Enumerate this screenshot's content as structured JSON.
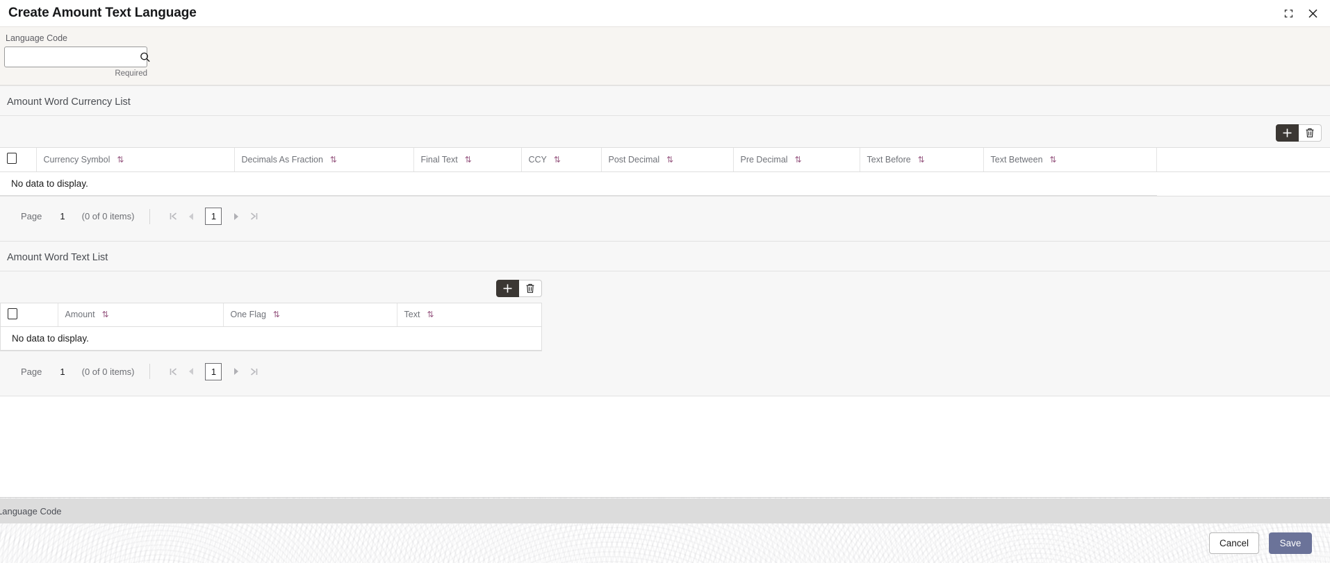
{
  "window": {
    "title": "Create Amount Text Language",
    "minimize_icon": "collapse-icon",
    "close_icon": "close-icon"
  },
  "form": {
    "language_code": {
      "label": "Language Code",
      "value": "",
      "placeholder": "",
      "hint": "Required",
      "search_icon": "search-icon"
    }
  },
  "sections": [
    {
      "title": "Amount Word Currency List",
      "toolbar": {
        "add_label": "+",
        "delete_icon": "trash-icon"
      },
      "table": {
        "columns": [
          "Currency Symbol",
          "Decimals As Fraction",
          "Final Text",
          "CCY",
          "Post Decimal",
          "Pre Decimal",
          "Text Before",
          "Text Between"
        ],
        "rows": [],
        "empty_text": "No data to display."
      },
      "pager": {
        "page_label": "Page",
        "page_value": "1",
        "items_text": "(0 of 0 items)",
        "first": "|<",
        "prev": "◀",
        "current": "1",
        "next": "▶",
        "last": ">|"
      }
    },
    {
      "title": "Amount Word Text List",
      "toolbar": {
        "add_label": "+",
        "delete_icon": "trash-icon"
      },
      "table": {
        "columns": [
          "Amount",
          "One Flag",
          "Text"
        ],
        "rows": [],
        "empty_text": "No data to display."
      },
      "pager": {
        "page_label": "Page",
        "page_value": "1",
        "items_text": "(0 of 0 items)",
        "first": "|<",
        "prev": "◀",
        "current": "1",
        "next": "▶",
        "last": ">|"
      }
    }
  ],
  "status_bar": {
    "text": "Language Code"
  },
  "footer": {
    "cancel_label": "Cancel",
    "save_label": "Save"
  },
  "colors": {
    "accent_save": "#6b7399",
    "sort_icon": "#9b5f86",
    "add_button": "#3b3733",
    "form_strip": "#f7f5f2",
    "status_bar": "#dcdcdc"
  }
}
